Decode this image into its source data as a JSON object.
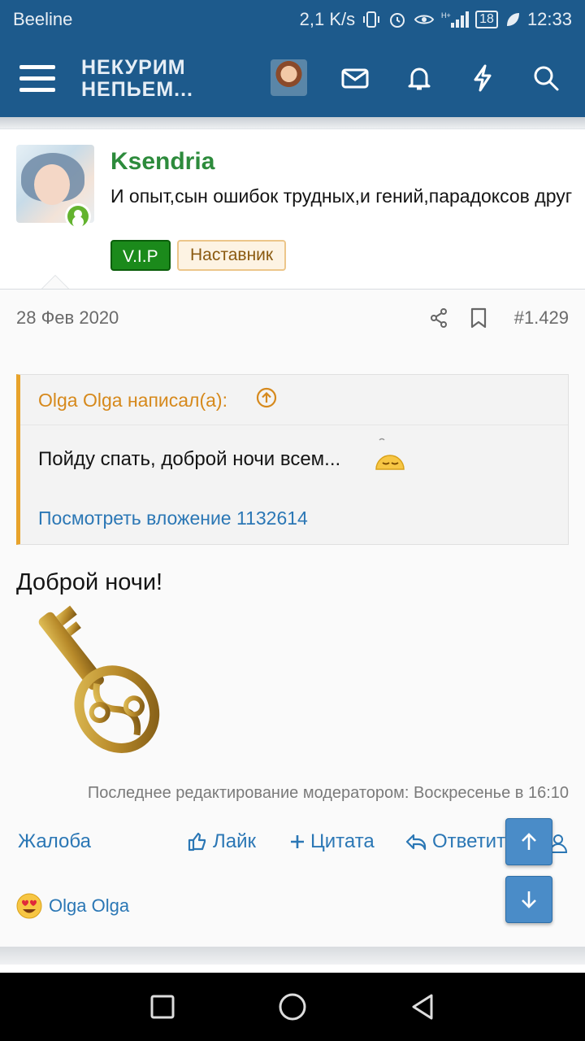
{
  "status_bar": {
    "carrier": "Beeline",
    "net_speed": "2,1 K/s",
    "battery": "18",
    "time": "12:33"
  },
  "app_bar": {
    "logo_line1": "НЕКУРИМ",
    "logo_line2": "НЕПЬЕМ..."
  },
  "post": {
    "author": "Ksendria",
    "user_title": "И опыт,сын ошибок трудных,и гений,парадоксов друг",
    "badges": [
      "V.I.P",
      "Наставник"
    ],
    "date": "28 Фев 2020",
    "number": "#1.429",
    "quote": {
      "author_line": "Olga Olga написал(а):",
      "text": "Пойду спать, доброй ночи всем...",
      "attachment_link": "Посмотреть вложение 1132614"
    },
    "message": "Доброй ночи!",
    "edit_note": "Последнее редактирование модератором: Воскресенье в 16:10",
    "actions": {
      "report": "Жалоба",
      "like": "Лайк",
      "quote": "Цитата",
      "reply": "Ответить"
    },
    "reaction_user": "Olga Olga"
  },
  "colors": {
    "brand": "#1d5a8c",
    "link": "#2b77b5",
    "username": "#2d8b3c",
    "quote_accent": "#e8a32b"
  }
}
